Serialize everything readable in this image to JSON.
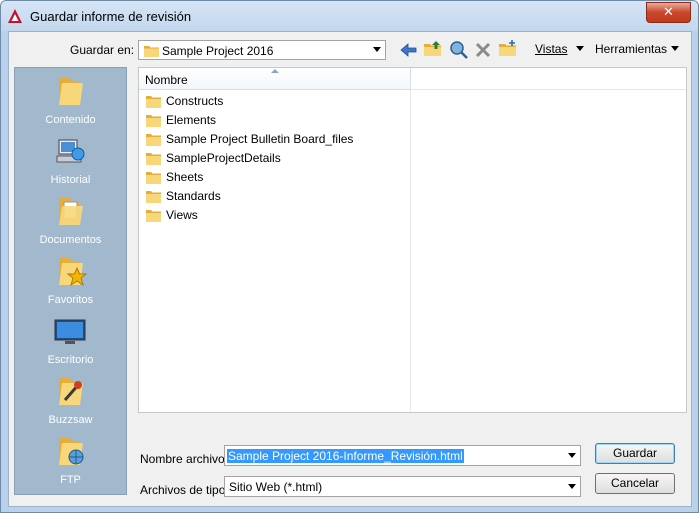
{
  "window": {
    "title": "Guardar informe de revisión",
    "close_glyph": "✕"
  },
  "toolbar": {
    "save_in_label": "Guardar en:",
    "location": "Sample Project 2016",
    "icons": [
      "back-icon",
      "up-folder-icon",
      "search-web-icon",
      "delete-icon",
      "new-folder-icon"
    ],
    "views_label": "Vistas",
    "tools_label": "Herramientas"
  },
  "places": [
    {
      "label": "Contenido",
      "icon": "folder-content-icon"
    },
    {
      "label": "Historial",
      "icon": "history-icon"
    },
    {
      "label": "Documentos",
      "icon": "documents-icon"
    },
    {
      "label": "Favoritos",
      "icon": "favorites-icon"
    },
    {
      "label": "Escritorio",
      "icon": "desktop-icon"
    },
    {
      "label": "Buzzsaw",
      "icon": "buzzsaw-icon"
    },
    {
      "label": "FTP",
      "icon": "ftp-icon"
    }
  ],
  "file_list": {
    "column_name": "Nombre",
    "items": [
      "Constructs",
      "Elements",
      "Sample Project Bulletin Board_files",
      "SampleProjectDetails",
      "Sheets",
      "Standards",
      "Views"
    ]
  },
  "form": {
    "filename_label": "Nombre archivo:",
    "filename_value": "Sample Project 2016-Informe_Revisión.html",
    "filetype_label": "Archivos de tipo:",
    "filetype_value": "Sitio Web (*.html)",
    "save_button": "Guardar",
    "cancel_button": "Cancelar"
  },
  "colors": {
    "places_bg": "#a2b8cc",
    "selection": "#3399ff",
    "close_button": "#c9462c",
    "folder": "#f2c75c"
  }
}
